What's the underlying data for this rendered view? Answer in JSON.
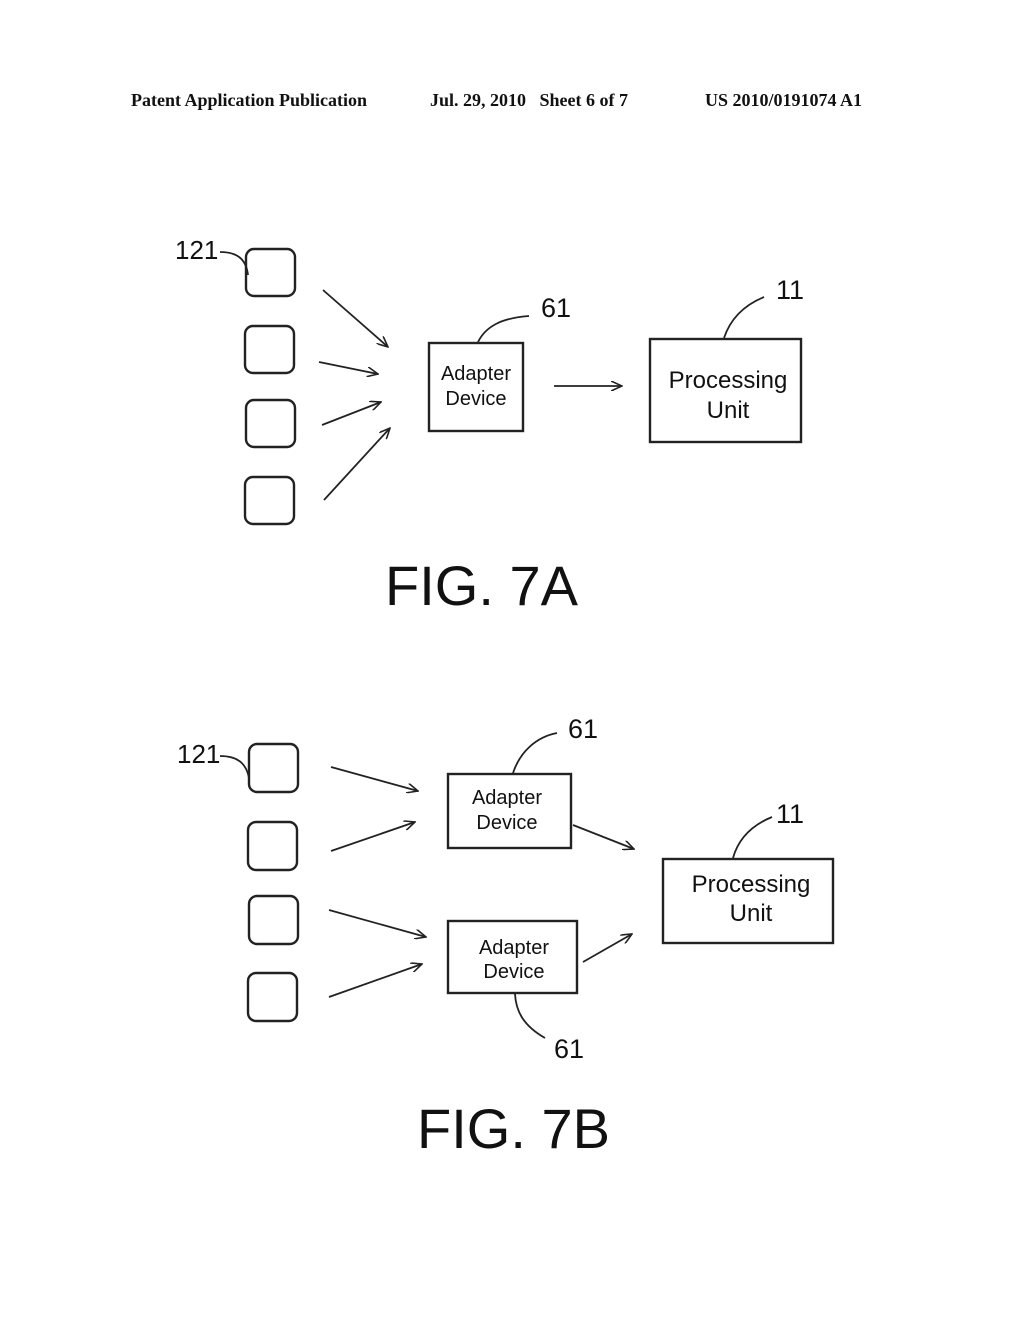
{
  "header": {
    "publication": "Patent Application Publication",
    "date_sheet": "Jul. 29, 2010   Sheet 6 of 7",
    "number": "US 2010/0191074 A1"
  },
  "fig7a": {
    "caption": "FIG. 7A",
    "sensor_ref": "121",
    "adapter_ref": "61",
    "adapter_label_line1": "Adapter",
    "adapter_label_line2": "Device",
    "processing_ref": "11",
    "processing_label_line1": "Processing",
    "processing_label_line2": "Unit"
  },
  "fig7b": {
    "caption": "FIG. 7B",
    "sensor_ref": "121",
    "adapter_top_ref": "61",
    "adapter_bottom_ref": "61",
    "adapter_label_line1": "Adapter",
    "adapter_label_line2": "Device",
    "processing_ref": "11",
    "processing_label_line1": "Processing",
    "processing_label_line2": "Unit"
  }
}
